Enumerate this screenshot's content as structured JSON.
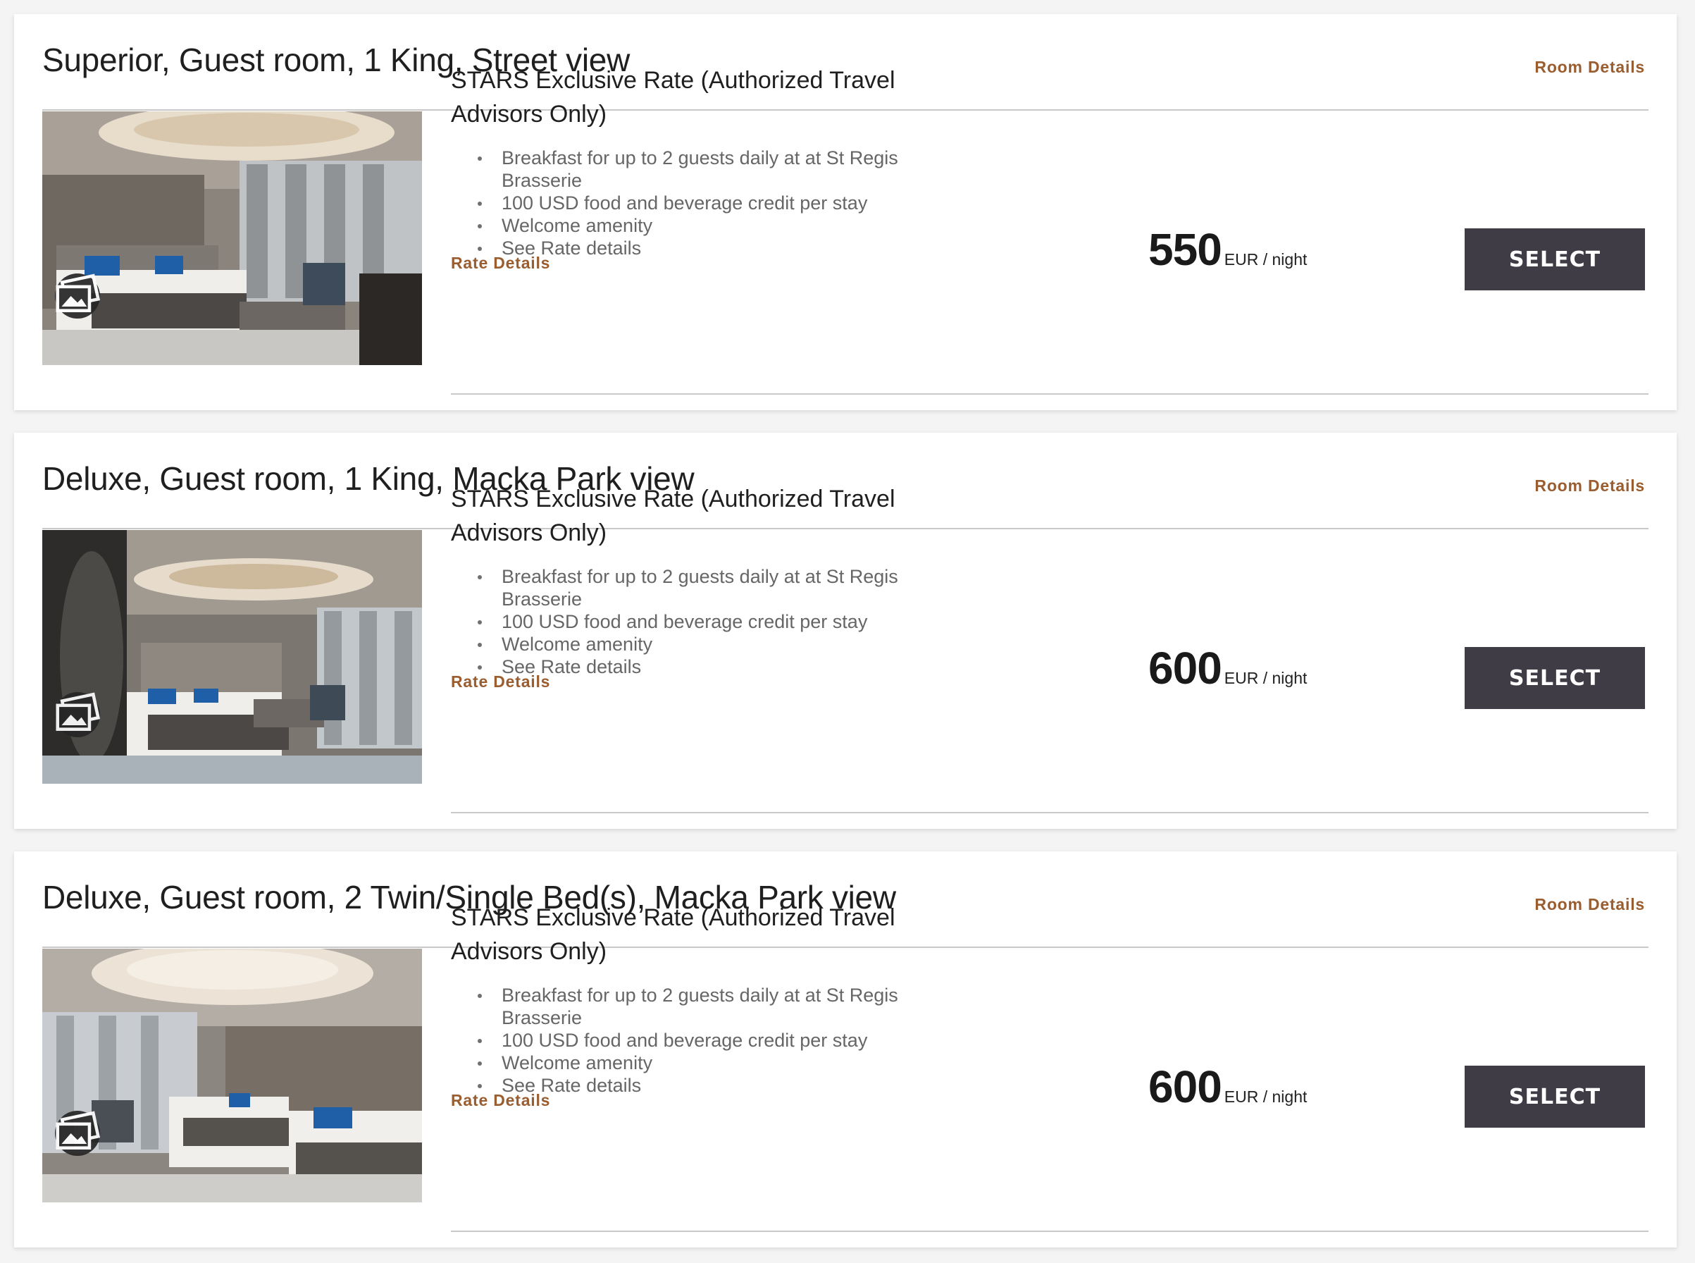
{
  "rooms": [
    {
      "title": "Superior, Guest room, 1 King, Street view",
      "room_details_label": "Room Details",
      "rate": {
        "title_line1": "STARS Exclusive Rate (Authorized Travel",
        "title_line2": "Advisors Only)",
        "benefits": [
          "Breakfast for up to 2 guests daily at at St Regis Brasserie",
          "100 USD food and beverage credit per stay",
          "Welcome amenity",
          "See Rate details"
        ],
        "rate_details_label": "Rate Details"
      },
      "price": {
        "amount": "550",
        "unit": "EUR / night"
      },
      "select_label": "SELECT",
      "photo_icon": "gallery-icon"
    },
    {
      "title": "Deluxe, Guest room, 1 King, Macka Park view",
      "room_details_label": "Room Details",
      "rate": {
        "title_line1": "STARS Exclusive Rate (Authorized Travel",
        "title_line2": "Advisors Only)",
        "benefits": [
          "Breakfast for up to 2 guests daily at at St Regis Brasserie",
          "100 USD food and beverage credit per stay",
          "Welcome amenity",
          "See Rate details"
        ],
        "rate_details_label": "Rate Details"
      },
      "price": {
        "amount": "600",
        "unit": "EUR / night"
      },
      "select_label": "SELECT",
      "photo_icon": "gallery-icon"
    },
    {
      "title": "Deluxe, Guest room, 2 Twin/Single Bed(s), Macka Park view",
      "room_details_label": "Room Details",
      "rate": {
        "title_line1": "STARS Exclusive Rate (Authorized Travel",
        "title_line2": "Advisors Only)",
        "benefits": [
          "Breakfast for up to 2 guests daily at at St Regis Brasserie",
          "100 USD food and beverage credit per stay",
          "Welcome amenity",
          "See Rate details"
        ],
        "rate_details_label": "Rate Details"
      },
      "price": {
        "amount": "600",
        "unit": "EUR / night"
      },
      "select_label": "SELECT",
      "photo_icon": "gallery-icon"
    }
  ],
  "colors": {
    "link": "#9a5d2f",
    "button": "#403c46",
    "divider": "#c9c9c9",
    "background": "#f4f4f4"
  }
}
